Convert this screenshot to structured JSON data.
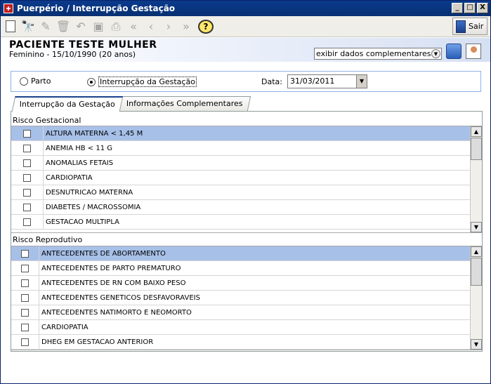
{
  "window": {
    "title": "Puerpério / Interrupção Gestação",
    "buttons": [
      "_",
      "□",
      "X"
    ]
  },
  "toolbar": {
    "icons": [
      "new-icon",
      "search-icon",
      "edit-icon",
      "delete-icon",
      "undo-icon",
      "save-icon",
      "print-icon",
      "first-icon",
      "prev-icon",
      "next-icon",
      "last-icon",
      "help-icon"
    ],
    "help_label": "?",
    "exit_label": "Sair"
  },
  "patient": {
    "name": "PACIENTE TESTE MULHER",
    "info": "Feminino - 15/10/1990 (20 anos)",
    "extra_select": "exibir dados complementares..."
  },
  "form": {
    "option_parto": "Parto",
    "option_interrupcao": "Interrupção da Gestação",
    "selected_option": "interrupcao",
    "date_label": "Data:",
    "date_value": "31/03/2011"
  },
  "tabs": [
    {
      "label": "Interrupção da Gestação",
      "active": true
    },
    {
      "label": "Informações Complementares",
      "active": false
    }
  ],
  "risco_gestacional": {
    "label": "Risco Gestacional",
    "items": [
      "ALTURA MATERNA < 1,45 M",
      "ANEMIA HB < 11 G",
      "ANOMALIAS FETAIS",
      "CARDIOPATIA",
      "DESNUTRICAO MATERNA",
      "DIABETES / MACROSSOMIA",
      "GESTACAO MULTIPLA"
    ]
  },
  "risco_reprodutivo": {
    "label": "Risco Reprodutivo",
    "items": [
      "ANTECEDENTES DE ABORTAMENTO",
      "ANTECEDENTES DE PARTO PREMATURO",
      "ANTECEDENTES DE RN COM BAIXO PESO",
      "ANTECEDENTES GENETICOS DESFAVORAVEIS",
      "ANTECEDENTES NATIMORTO E NEOMORTO",
      "CARDIOPATIA",
      "DHEG EM GESTACAO ANTERIOR"
    ]
  }
}
